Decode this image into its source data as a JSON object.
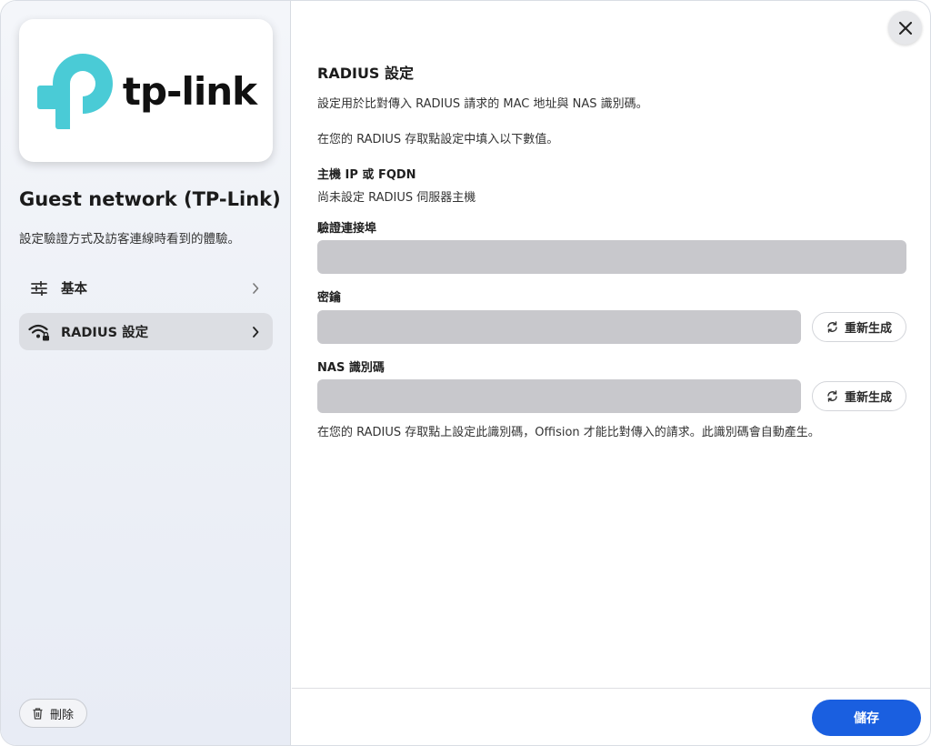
{
  "sidebar": {
    "logo_text": "tp-link",
    "network_title": "Guest network (TP-Link)",
    "network_description": "設定驗證方式及訪客連線時看到的體驗。",
    "nav": [
      {
        "label": "基本",
        "icon": "sliders-icon",
        "active": false
      },
      {
        "label": "RADIUS 設定",
        "icon": "wifi-lock-icon",
        "active": true
      }
    ],
    "delete_label": "刪除"
  },
  "main": {
    "title": "RADIUS 設定",
    "description": "設定用於比對傳入 RADIUS 請求的 MAC 地址與 NAS 識別碼。",
    "instruction": "在您的 RADIUS 存取點設定中填入以下數值。",
    "host": {
      "label": "主機 IP 或 FQDN",
      "value": "尚未設定 RADIUS 伺服器主機"
    },
    "auth_port": {
      "label": "驗證連接埠",
      "value": ""
    },
    "secret": {
      "label": "密鑰",
      "value": "",
      "regenerate_label": "重新生成"
    },
    "nas_id": {
      "label": "NAS 識別碼",
      "value": "",
      "regenerate_label": "重新生成",
      "help": "在您的 RADIUS 存取點上設定此識別碼，Offision 才能比對傳入的請求。此識別碼會自動產生。"
    },
    "save_label": "儲存"
  },
  "colors": {
    "accent": "#1a5fe0",
    "logo_teal": "#4acbd6",
    "field_bg": "#c8c8cc",
    "active_nav_bg": "#dcdee3"
  }
}
